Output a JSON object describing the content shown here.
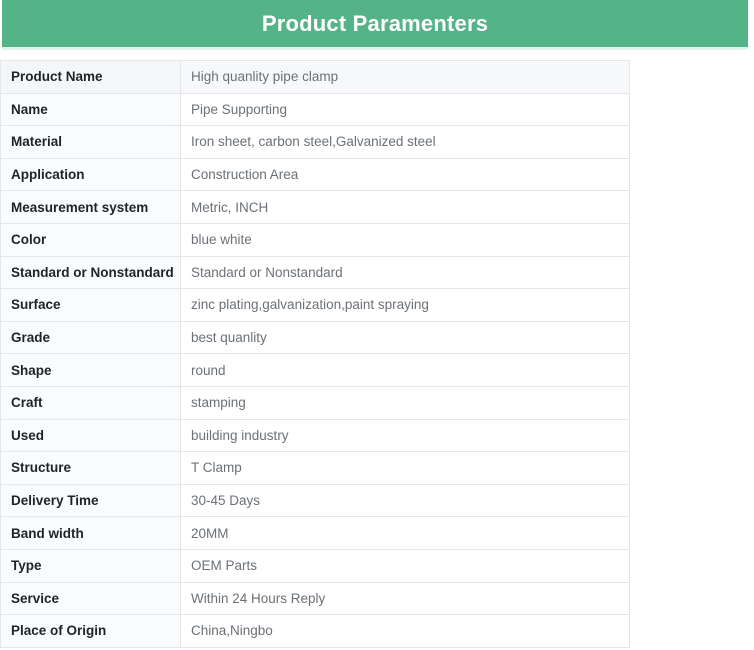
{
  "banner": {
    "title": "Product Paramenters",
    "background_color": "#54b387",
    "text_color": "#ffffff",
    "underline_color": "#dff3ec"
  },
  "table": {
    "border_color": "#e4e6e9",
    "label_color": "#1f2328",
    "value_color": "#6b7177",
    "rows": [
      {
        "label": "Product Name",
        "value": "High quanlity  pipe clamp"
      },
      {
        "label": "Name",
        "value": "Pipe Supporting"
      },
      {
        "label": "Material",
        "value": "Iron sheet, carbon steel,Galvanized steel"
      },
      {
        "label": "Application",
        "value": "Construction Area"
      },
      {
        "label": "Measurement system",
        "value": "Metric, INCH"
      },
      {
        "label": "Color",
        "value": "blue white"
      },
      {
        "label": "Standard or Nonstandard",
        "value": "Standard or Nonstandard"
      },
      {
        "label": "Surface",
        "value": "zinc plating,galvanization,paint spraying"
      },
      {
        "label": "Grade",
        "value": "best quanlity"
      },
      {
        "label": "Shape",
        "value": "round"
      },
      {
        "label": "Craft",
        "value": "stamping"
      },
      {
        "label": "Used",
        "value": "building industry"
      },
      {
        "label": "Structure",
        "value": "T Clamp"
      },
      {
        "label": "Delivery Time",
        "value": "30-45 Days"
      },
      {
        "label": "Band width",
        "value": "20MM"
      },
      {
        "label": "Type",
        "value": "OEM Parts"
      },
      {
        "label": "Service",
        "value": "Within 24 Hours Reply"
      },
      {
        "label": "Place of Origin",
        "value": "China,Ningbo"
      }
    ]
  }
}
